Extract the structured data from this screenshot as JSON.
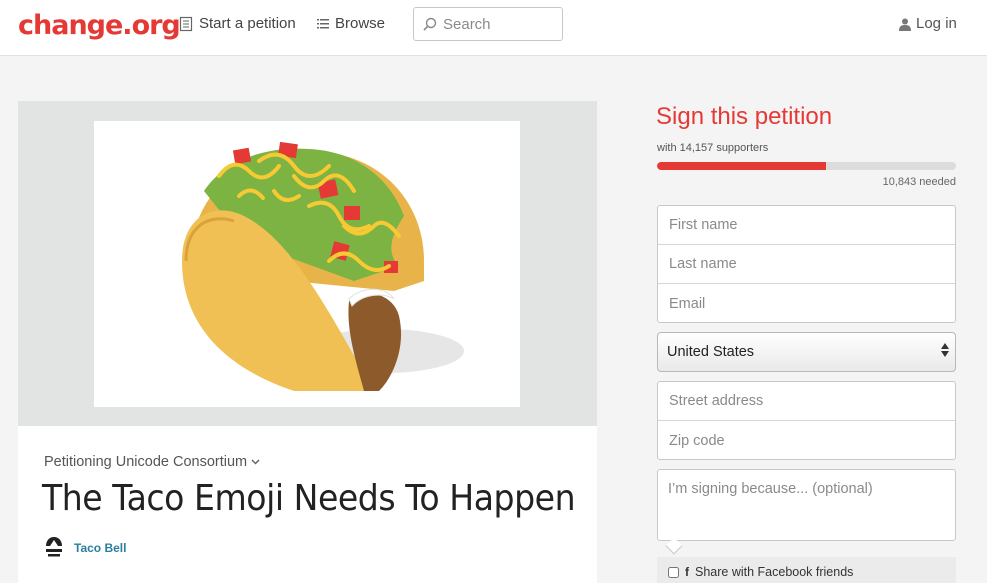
{
  "header": {
    "logo": "change.org",
    "nav": {
      "start_label": "Start a petition",
      "browse_label": "Browse"
    },
    "search_placeholder": "Search",
    "login_label": "Log in",
    "icons": {
      "start": "petition-icon",
      "browse": "list-icon",
      "search": "search-icon",
      "login": "user-icon"
    }
  },
  "petition": {
    "petitioning": "Petitioning Unicode Consortium",
    "title": "The Taco Emoji Needs To Happen",
    "author": "Taco Bell",
    "image": "taco-emoji-illustration"
  },
  "sign": {
    "title": "Sign this petition",
    "supporters": "with 14,157 supporters",
    "progress": 0.566,
    "needed": "10,843 needed",
    "fields": {
      "first_name": "First name",
      "last_name": "Last name",
      "email": "Email",
      "country": "United States",
      "street": "Street address",
      "zip": "Zip code",
      "reason": "I’m signing because... (optional)"
    },
    "share_label": "Share with Facebook friends"
  },
  "colors": {
    "brand": "#e53935",
    "link": "#2a7fa0",
    "media_bg": "#e2e4e4"
  }
}
